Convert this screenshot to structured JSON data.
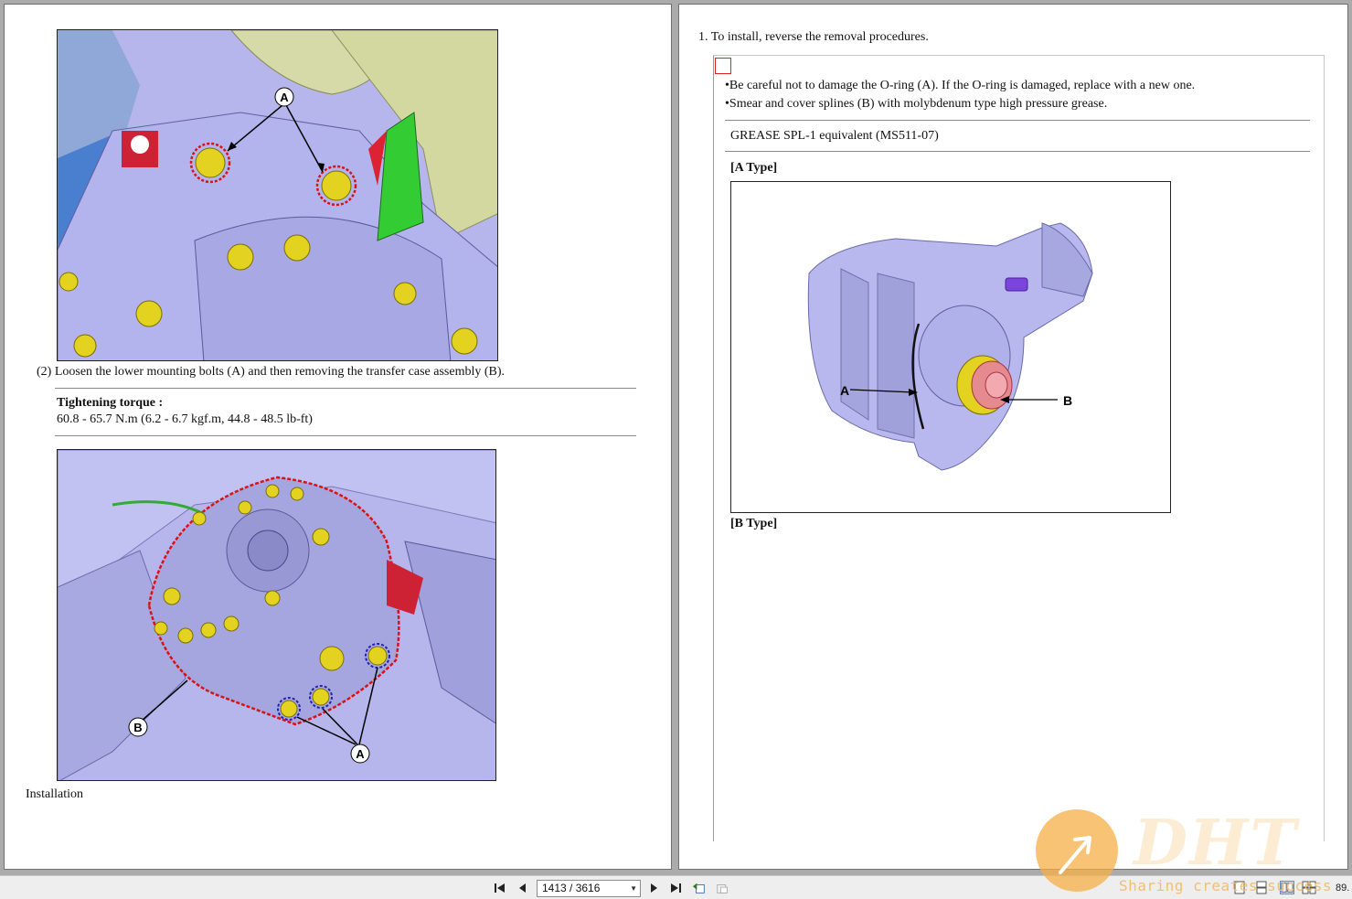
{
  "left_page": {
    "step2_text": "(2) Loosen the lower mounting bolts (A) and then removing the transfer case assembly (B).",
    "torque_label": "Tightening torque :",
    "torque_value": "60.8 - 65.7 N.m (6.2 - 6.7 kgf.m, 44.8 - 48.5 lb-ft)",
    "fig1_label_a": "A",
    "fig2_label_a": "A",
    "fig2_label_b": "B",
    "section_heading": "Installation"
  },
  "right_page": {
    "step1_text": "1. To install, reverse the removal procedures.",
    "note_line1": "•Be careful not to damage the O-ring (A). If the O-ring is damaged, replace with a new one.",
    "note_line2": "•Smear and cover splines (B) with molybdenum type high pressure grease.",
    "grease_spec": "GREASE SPL-1 equivalent (MS511-07)",
    "a_type_heading": "[A Type]",
    "b_type_heading": "[B Type]",
    "fig3_label_a": "A",
    "fig3_label_b": "B"
  },
  "toolbar": {
    "page_indicator": "1413 / 3616",
    "zoom": "89."
  },
  "watermark": {
    "logo": "DHT",
    "tagline": "Sharing creates success"
  },
  "colors": {
    "part_body": "#b3b3ee",
    "bolt": "#e0d020",
    "highlight_dash": "#dd1111",
    "accent_red": "#cc2233",
    "accent_green": "#33cc33"
  }
}
